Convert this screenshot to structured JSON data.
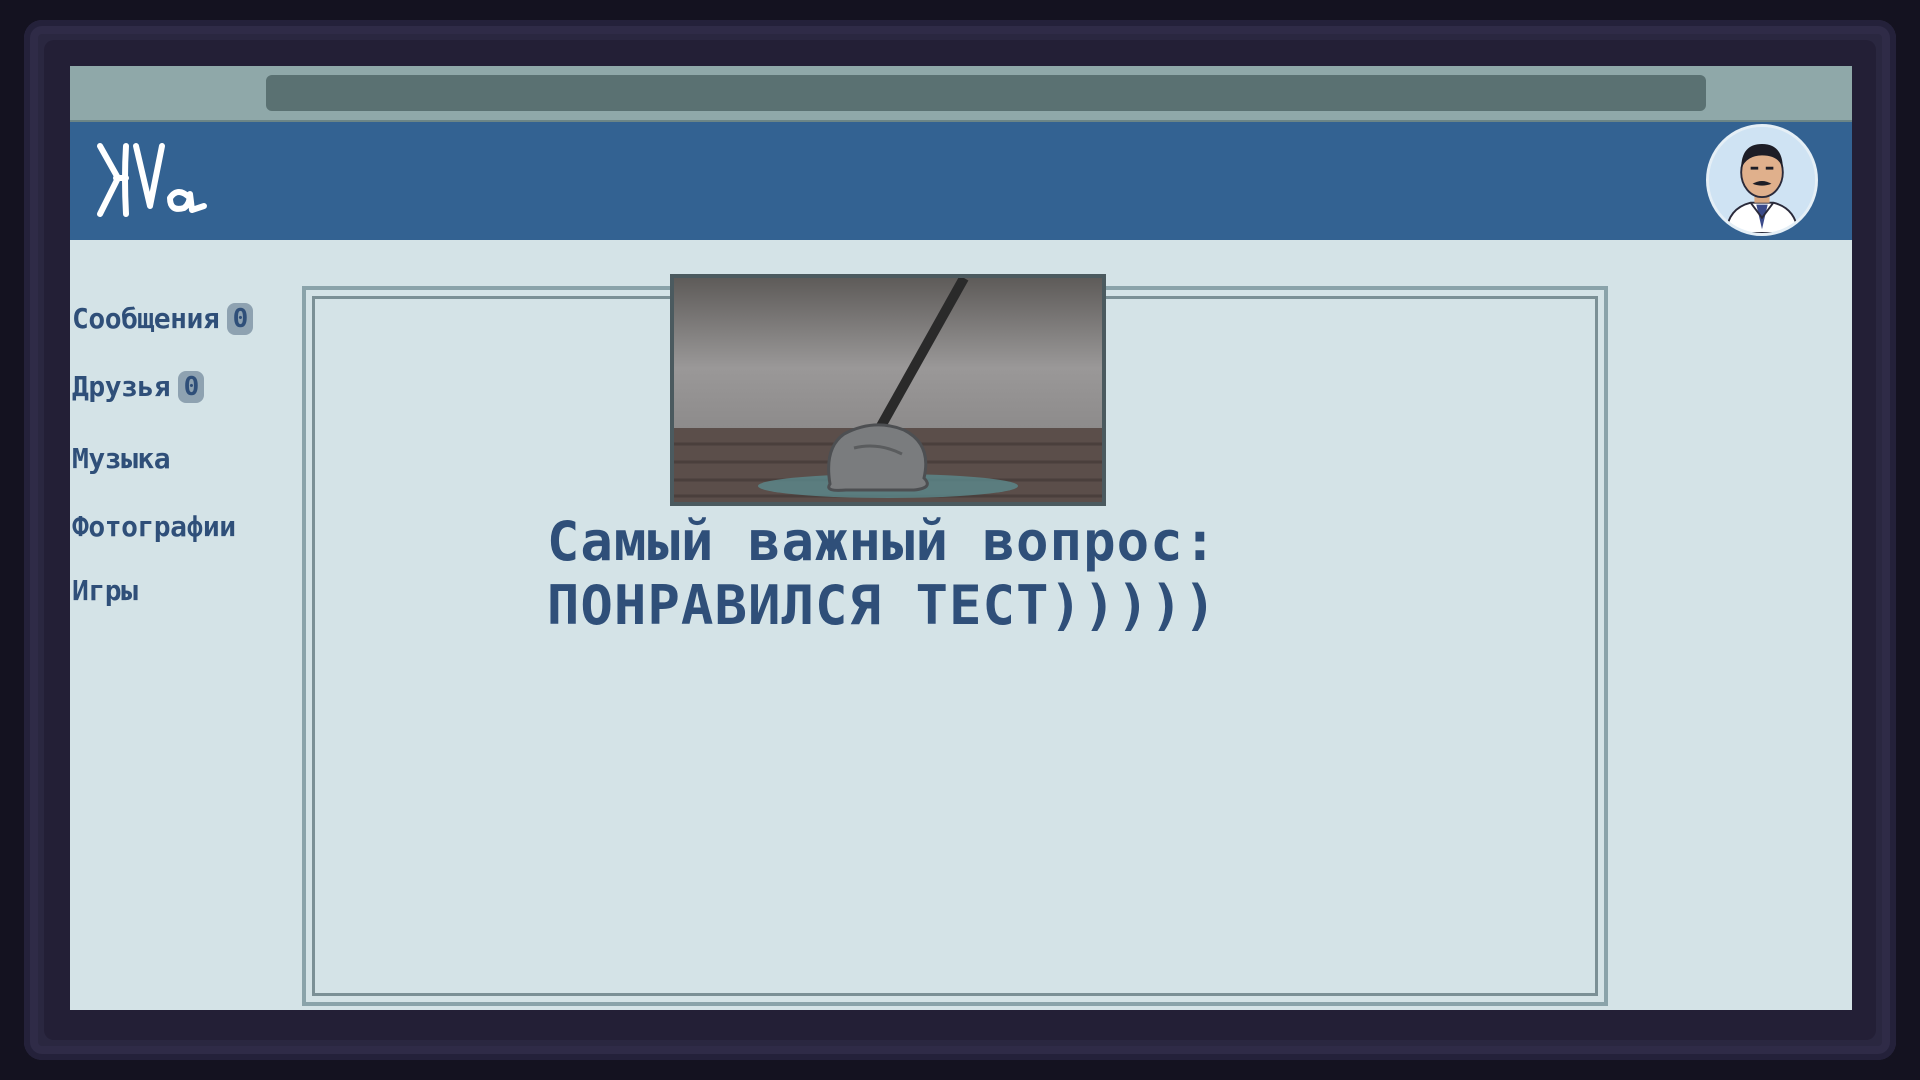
{
  "sidebar": {
    "items": [
      {
        "label": "Сообщения",
        "badge": "0"
      },
      {
        "label": "Друзья",
        "badge": "0"
      },
      {
        "label": "Музыка"
      },
      {
        "label": "Фотографии"
      },
      {
        "label": "Игры"
      }
    ]
  },
  "post": {
    "line1": "Самый важный вопрос:",
    "line2": "ПОНРАВИЛСЯ ТЕСТ)))))"
  },
  "colors": {
    "header": "#336292",
    "text": "#2f4f79",
    "background": "#d4e3e7"
  }
}
